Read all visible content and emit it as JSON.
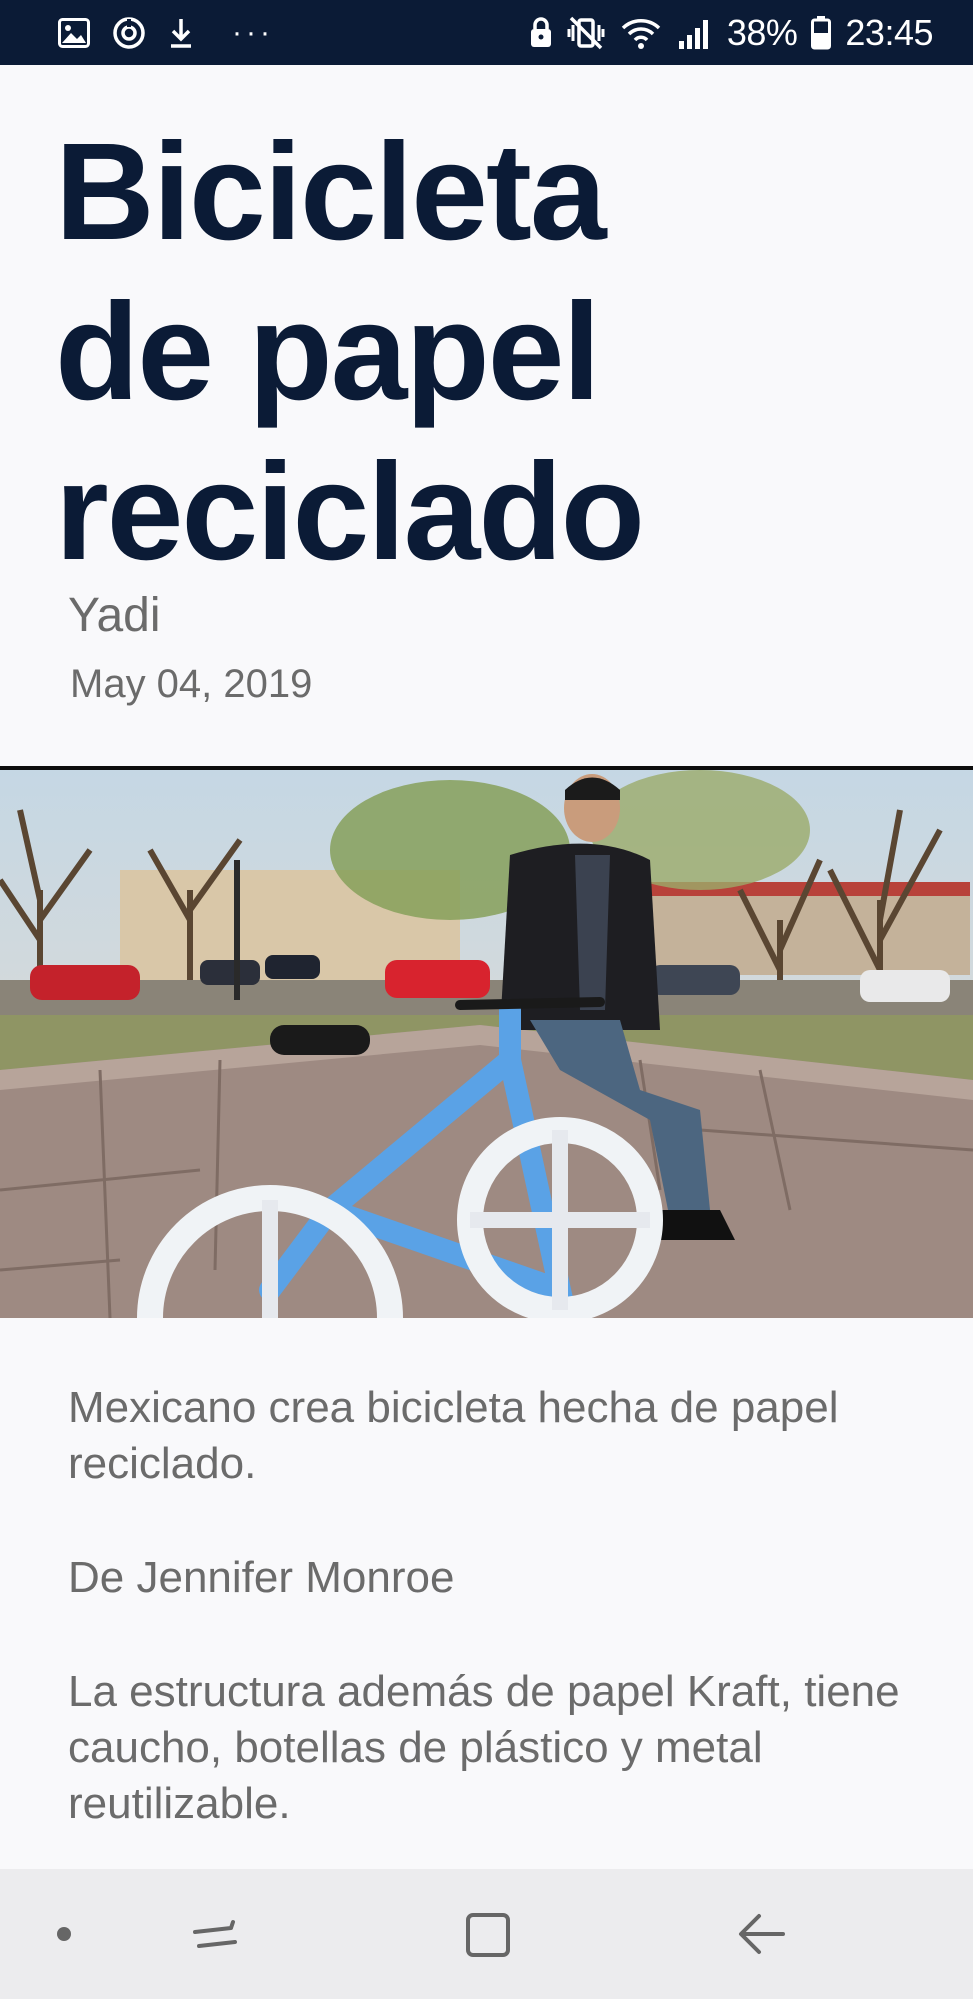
{
  "status_bar": {
    "left_icons": [
      "image-icon",
      "sync-icon",
      "download-icon"
    ],
    "more": "···",
    "right_icons": [
      "lock-icon",
      "vibrate-mute-icon",
      "wifi-icon",
      "signal-icon"
    ],
    "battery": "38%",
    "time": "23:45",
    "background": "#0b1b36"
  },
  "article": {
    "title": "Bicicleta de papel reciclado",
    "author": "Yadi",
    "date": "May 04, 2019",
    "image_alt": "man-with-paper-bicycle-photo",
    "paragraphs": [
      "Mexicano crea bicicleta hecha de papel reciclado.",
      "De Jennifer Monroe",
      "La estructura además de papel Kraft, tiene caucho, botellas de plástico y metal reutilizable."
    ],
    "title_color": "#0b1b36",
    "text_color": "#6b6b6b"
  },
  "nav_bar": {
    "items": [
      "dot-icon",
      "recent-apps-icon",
      "home-icon",
      "back-icon"
    ],
    "background": "#ececee"
  }
}
